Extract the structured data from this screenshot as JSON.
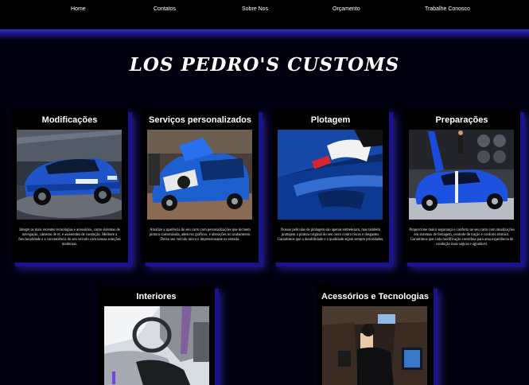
{
  "nav": {
    "items": [
      {
        "label": "Home"
      },
      {
        "label": "Contatos"
      },
      {
        "label": "Sobre Nos"
      },
      {
        "label": "Orçamento"
      },
      {
        "label": "Trabalhe Conosco"
      }
    ]
  },
  "brand": {
    "title": "LOS PEDRO'S CUSTOMS"
  },
  "services": [
    {
      "title": "Modificações",
      "description": "Integre as mais recentes tecnologias e acessórios, como sistemas de navegação, câmeras de ré, e assistentes de condução. Melhore a funcionalidade e a conveniência do seu veículo com nossas soluções modernas."
    },
    {
      "title": "Serviços personalizados",
      "description": "Atualize a aparência do seu carro com personalizações que incluem pintura customizada, adesivos gráficos, e alterações no acabamento. Deixe seu veículo único e impressionante na estrada."
    },
    {
      "title": "Plotagem",
      "description": "Nossas películas de plotagem são apenas embelezam, mas também protegem a pintura original do seu carro contra riscos e desgastes. Garantimos que a durabilidade e a qualidade sejam sempre prioridades."
    },
    {
      "title": "Preparações",
      "description": "Proporcione maior segurança e conforto ao seu carro com atualizações em sistemas de frenagem, controle de tração e conforto térmico. Garantimos que cada modificação contribua para uma experiência de condução mais segura e agradável."
    },
    {
      "title": "Interiores",
      "description": ""
    },
    {
      "title": "Acessórios e Tecnologias",
      "description": ""
    }
  ],
  "colors": {
    "background": "#02010f",
    "card": "#000000",
    "glow": "#3a2fd8",
    "text": "#ffffff"
  }
}
